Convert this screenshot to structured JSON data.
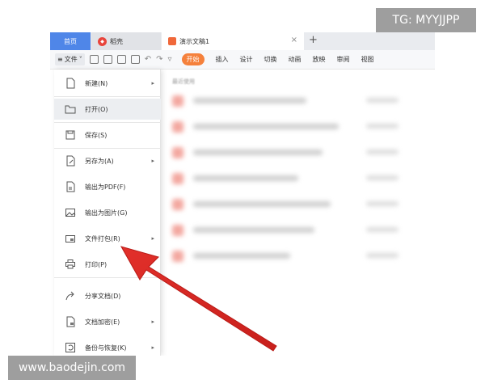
{
  "titlebar": {
    "home_tab": "首页",
    "dao_tab": "稻壳",
    "doc_tab": "演示文稿1",
    "close_glyph": "×",
    "add_glyph": "+"
  },
  "toolbar": {
    "menu_label": "文件",
    "menu_glyph": "≡",
    "start_tab": "开始",
    "ribbon_tabs": [
      "插入",
      "设计",
      "切换",
      "动画",
      "放映",
      "审阅",
      "视图"
    ]
  },
  "file_menu": {
    "items": [
      {
        "label": "新建(N)",
        "icon": "new-file-icon",
        "has_submenu": true
      },
      {
        "label": "打开(O)",
        "icon": "folder-icon",
        "has_submenu": false
      },
      {
        "label": "保存(S)",
        "icon": "save-icon",
        "has_submenu": false
      },
      {
        "label": "另存为(A)",
        "icon": "save-as-icon",
        "has_submenu": true
      },
      {
        "label": "输出为PDF(F)",
        "icon": "pdf-icon",
        "has_submenu": false
      },
      {
        "label": "输出为图片(G)",
        "icon": "image-icon",
        "has_submenu": false
      },
      {
        "label": "文件打包(R)",
        "icon": "package-icon",
        "has_submenu": true
      },
      {
        "label": "打印(P)",
        "icon": "printer-icon",
        "has_submenu": false
      },
      {
        "label": "分享文档(D)",
        "icon": "share-icon",
        "has_submenu": false
      },
      {
        "label": "文档加密(E)",
        "icon": "lock-icon",
        "has_submenu": true
      },
      {
        "label": "备份与恢复(K)",
        "icon": "backup-icon",
        "has_submenu": true
      }
    ],
    "highlighted_item": "打开(O)"
  },
  "recent": {
    "title": "最近使用"
  },
  "watermarks": {
    "top_right": "TG: MYYJJPP",
    "bottom_left": "www.baodejin.com"
  },
  "colors": {
    "accent_blue": "#4f86e8",
    "start_orange": "#f5813c",
    "arrow_red": "#e2302b"
  }
}
